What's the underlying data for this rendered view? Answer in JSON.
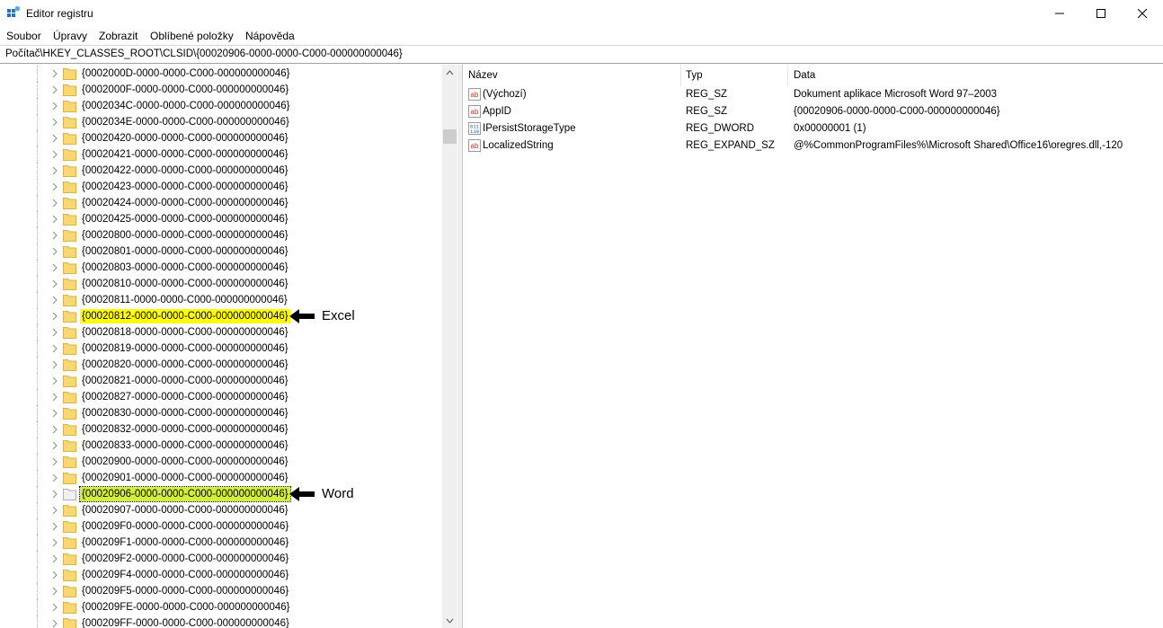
{
  "window": {
    "title": "Editor registru"
  },
  "menu": [
    "Soubor",
    "Úpravy",
    "Zobrazit",
    "Oblíbené položky",
    "Nápověda"
  ],
  "address": "Počítač\\HKEY_CLASSES_ROOT\\CLSID\\{00020906-0000-0000-C000-000000000046}",
  "tree": [
    "{0002000D-0000-0000-C000-000000000046}",
    "{0002000F-0000-0000-C000-000000000046}",
    "{0002034C-0000-0000-C000-000000000046}",
    "{0002034E-0000-0000-C000-000000000046}",
    "{00020420-0000-0000-C000-000000000046}",
    "{00020421-0000-0000-C000-000000000046}",
    "{00020422-0000-0000-C000-000000000046}",
    "{00020423-0000-0000-C000-000000000046}",
    "{00020424-0000-0000-C000-000000000046}",
    "{00020425-0000-0000-C000-000000000046}",
    "{00020800-0000-0000-C000-000000000046}",
    "{00020801-0000-0000-C000-000000000046}",
    "{00020803-0000-0000-C000-000000000046}",
    "{00020810-0000-0000-C000-000000000046}",
    "{00020811-0000-0000-C000-000000000046}",
    "{00020812-0000-0000-C000-000000000046}",
    "{00020818-0000-0000-C000-000000000046}",
    "{00020819-0000-0000-C000-000000000046}",
    "{00020820-0000-0000-C000-000000000046}",
    "{00020821-0000-0000-C000-000000000046}",
    "{00020827-0000-0000-C000-000000000046}",
    "{00020830-0000-0000-C000-000000000046}",
    "{00020832-0000-0000-C000-000000000046}",
    "{00020833-0000-0000-C000-000000000046}",
    "{00020900-0000-0000-C000-000000000046}",
    "{00020901-0000-0000-C000-000000000046}",
    "{00020906-0000-0000-C000-000000000046}",
    "{00020907-0000-0000-C000-000000000046}",
    "{000209F0-0000-0000-C000-000000000046}",
    "{000209F1-0000-0000-C000-000000000046}",
    "{000209F2-0000-0000-C000-000000000046}",
    "{000209F4-0000-0000-C000-000000000046}",
    "{000209F5-0000-0000-C000-000000000046}",
    "{000209FE-0000-0000-C000-000000000046}",
    "{000209FF-0000-0000-C000-000000000046}"
  ],
  "highlights": {
    "excel_index": 15,
    "word_index": 26
  },
  "annotations": {
    "excel": "Excel",
    "word": "Word"
  },
  "columns": {
    "name": "Název",
    "type": "Typ",
    "data": "Data"
  },
  "values": [
    {
      "name": "(Výchozí)",
      "type": "REG_SZ",
      "data": "Dokument aplikace Microsoft Word 97–2003",
      "icon": "string-value-icon"
    },
    {
      "name": "AppID",
      "type": "REG_SZ",
      "data": "{00020906-0000-0000-C000-000000000046}",
      "icon": "string-value-icon"
    },
    {
      "name": "IPersistStorageType",
      "type": "REG_DWORD",
      "data": "0x00000001 (1)",
      "icon": "binary-value-icon"
    },
    {
      "name": "LocalizedString",
      "type": "REG_EXPAND_SZ",
      "data": "@%CommonProgramFiles%\\Microsoft Shared\\Office16\\oregres.dll,-120",
      "icon": "string-value-icon"
    }
  ],
  "colors": {
    "highlight": "#ffff00",
    "selection": "#cce8ff",
    "folder": "#f8d775"
  }
}
